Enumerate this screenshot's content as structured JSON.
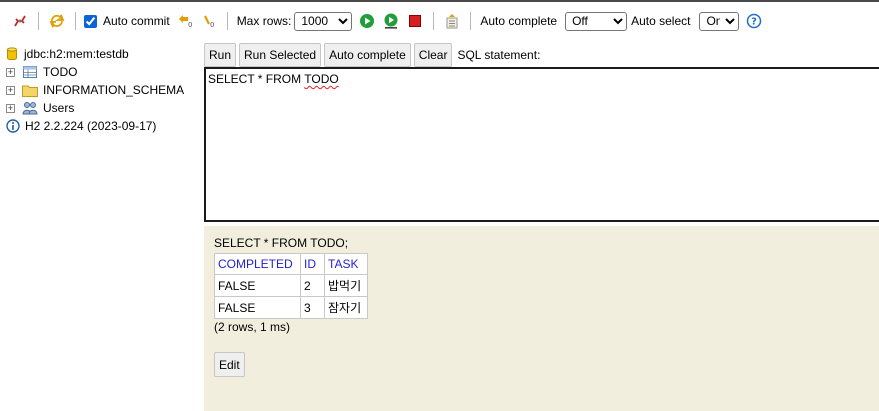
{
  "toolbar": {
    "auto_commit_label": "Auto commit",
    "auto_commit_checked": true,
    "max_rows_label": "Max rows:",
    "max_rows_value": "1000",
    "auto_complete_label": "Auto complete",
    "auto_complete_value": "Off",
    "auto_select_label": "Auto select",
    "auto_select_value": "On"
  },
  "tree": {
    "connection": "jdbc:h2:mem:testdb",
    "items": [
      {
        "label": "TODO"
      },
      {
        "label": "INFORMATION_SCHEMA"
      },
      {
        "label": "Users"
      }
    ],
    "version": "H2 2.2.224 (2023-09-17)"
  },
  "sql": {
    "run_label": "Run",
    "run_selected_label": "Run Selected",
    "auto_complete_label": "Auto complete",
    "clear_label": "Clear",
    "statement_label": "SQL statement:",
    "editor_text_prefix": "SELECT * FROM ",
    "editor_text_error": "TODO"
  },
  "result": {
    "query": "SELECT * FROM TODO;",
    "columns": [
      "COMPLETED",
      "ID",
      "TASK"
    ],
    "rows": [
      [
        "FALSE",
        "2",
        "밥먹기"
      ],
      [
        "FALSE",
        "3",
        "잠자기"
      ]
    ],
    "info": "(2 rows, 1 ms)",
    "edit_label": "Edit"
  },
  "colors": {
    "result_bg": "#f1eedd",
    "column_header": "#2222d0",
    "run_green": "#1f9e3a",
    "stop_red": "#d42020"
  }
}
